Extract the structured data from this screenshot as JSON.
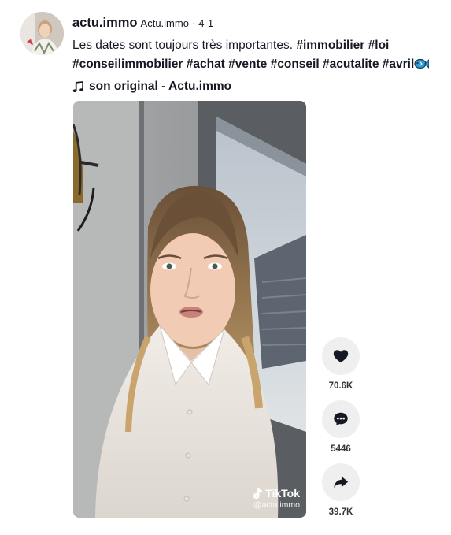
{
  "post": {
    "author": {
      "username": "actu.immo",
      "nickname": "Actu.immo",
      "separator": "·",
      "date": "4-1"
    },
    "caption": {
      "text": "Les dates sont toujours très importantes.",
      "hashtags": [
        "#immobilier",
        "#loi",
        "#conseilimmobilier",
        "#achat",
        "#vente",
        "#conseil",
        "#acutalite",
        "#avril"
      ],
      "emoji": "fish-emoji"
    },
    "music": {
      "icon": "music-note-icon",
      "label": "son original - Actu.immo"
    }
  },
  "video": {
    "watermark_brand": "TikTok",
    "watermark_user": "@actu.immo"
  },
  "actions": [
    {
      "icon": "heart-icon",
      "count": "70.6K"
    },
    {
      "icon": "comment-icon",
      "count": "5446"
    },
    {
      "icon": "share-icon",
      "count": "39.7K"
    }
  ],
  "colors": {
    "text": "#161823",
    "action_bg": "#efefef",
    "emoji_blue": "#2a9fd6"
  }
}
